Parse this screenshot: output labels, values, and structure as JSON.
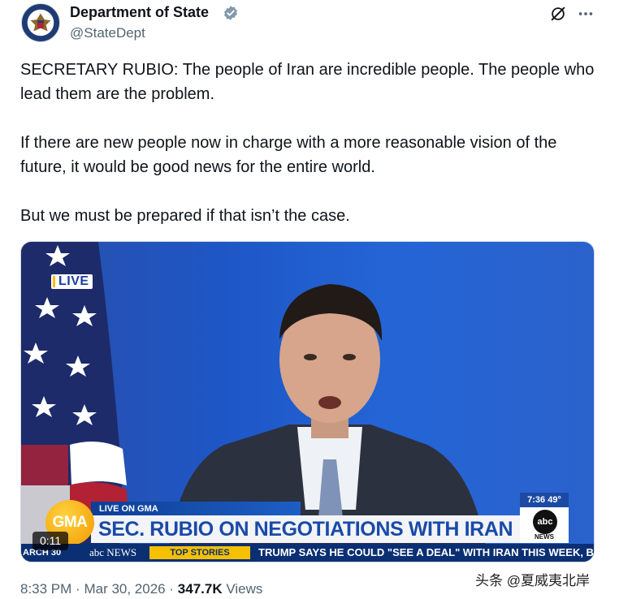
{
  "author": {
    "display_name": "Department of State",
    "handle": "@StateDept",
    "verified_icon": "verified-badge-icon",
    "colors": {
      "verified_badge": "#829aab"
    }
  },
  "header_actions": {
    "grok_icon": "grok-icon",
    "more_icon": "more-icon"
  },
  "tweet": {
    "paragraphs": [
      "SECRETARY RUBIO: The people of Iran are incredible people. The people who lead them are the problem.",
      "If there are new people now in charge with a more reasonable vision of the future, it would be good news for the entire world.",
      "But we must be prepared if that isn’t the case."
    ]
  },
  "video": {
    "live_badge": "LIVE",
    "lower_third_label": "LIVE ON GMA",
    "headline": "SEC. RUBIO ON NEGOTIATIONS WITH IRAN",
    "show_logo": "GMA",
    "weather": "7:36  49°",
    "network_logo": "abc",
    "network_name": "NEWS",
    "ticker_left": "ARCH 30",
    "ticker_brand": "abc NEWS",
    "ticker_tag": "TOP STORIES",
    "ticker_text": "TRUMP SAYS HE COULD \"SEE A DEAL\" WITH IRAN THIS WEEK, BU",
    "duration": "0:11"
  },
  "footer": {
    "time": "8:33 PM",
    "date": "Mar 30, 2026",
    "views_count": "347.7K",
    "views_label": "Views",
    "separator": "·"
  },
  "watermark": "头条 @夏威夷北岸"
}
